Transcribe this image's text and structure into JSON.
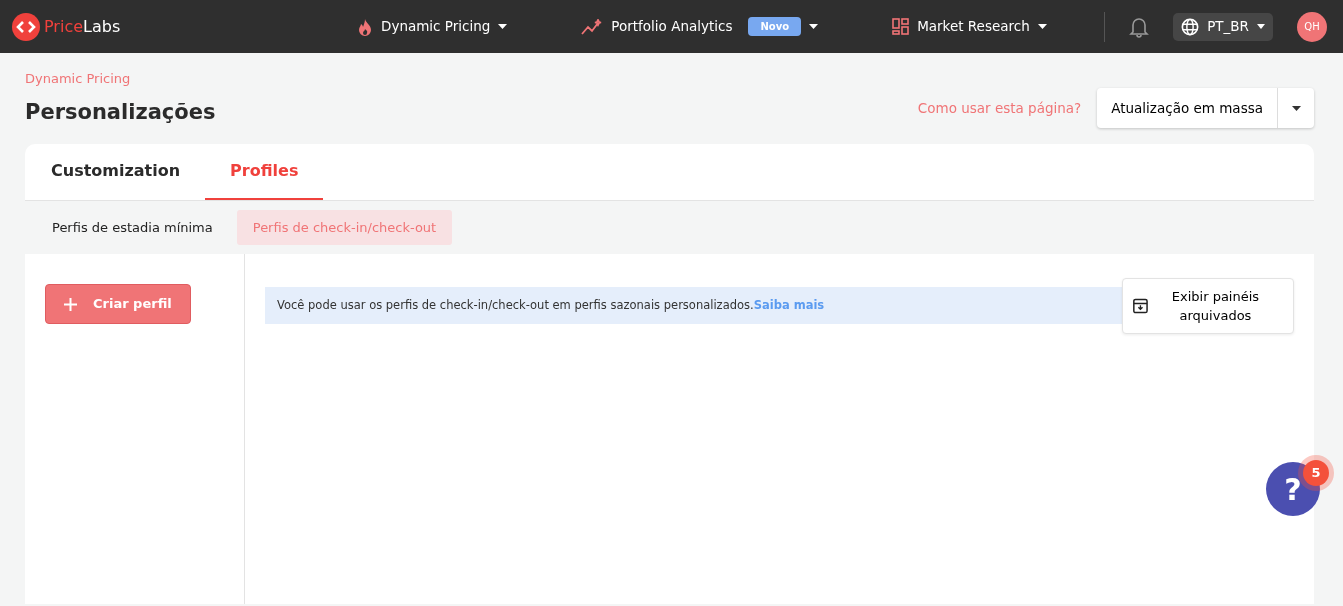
{
  "navbar": {
    "logo": {
      "first": "Price",
      "second": "Labs"
    },
    "menus": [
      {
        "label": "Dynamic Pricing"
      },
      {
        "label": "Portfolio Analytics",
        "badge": "Novo"
      },
      {
        "label": "Market Research"
      }
    ],
    "language": "PT_BR",
    "avatar": "QH"
  },
  "breadcrumb": "Dynamic Pricing",
  "title": "Personalizações",
  "help_link": "Como usar esta página?",
  "bulk_button": "Atualização em massa",
  "tabs": [
    {
      "label": "Customization",
      "selected": false
    },
    {
      "label": "Profiles",
      "selected": true
    }
  ],
  "subtabs": [
    {
      "label": "Perfis de estadia mínima",
      "selected": false
    },
    {
      "label": "Perfis de check-in/check-out",
      "selected": true
    }
  ],
  "create_button": "Criar perfil",
  "info": {
    "text": "Você pode usar os perfis de check-in/check-out em perfis sazonais personalizados.",
    "link": "Saiba mais"
  },
  "archive_button": "Exibir painéis arquivados",
  "help_widget": {
    "label": "?",
    "count": "5"
  }
}
